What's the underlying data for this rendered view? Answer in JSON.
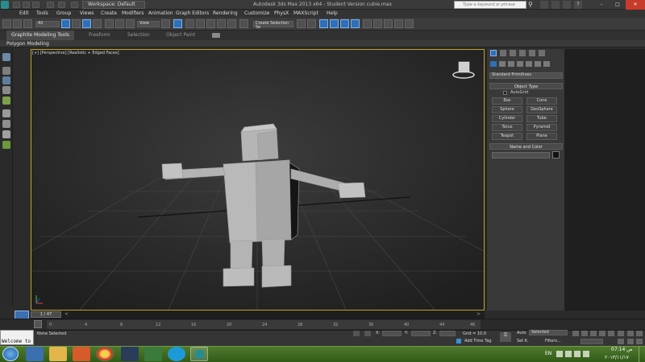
{
  "title_bar": {
    "title": "Autodesk 3ds Max  2013 x64  -  Student Version  cubie.max",
    "workspace": "Workspace: Default",
    "search_placeholder": "Type a keyword or phrase"
  },
  "menu": [
    "Edit",
    "Tools",
    "Group",
    "Views",
    "Create",
    "Modifiers",
    "Animation",
    "Graph Editors",
    "Rendering",
    "Customize",
    "MAXScript",
    "Help"
  ],
  "menu_extra": "PhysX",
  "toolbar": {
    "selection_filter": "All",
    "reference_coord": "View",
    "named_selection": "Create Selection Se"
  },
  "ribbon": {
    "tabs": [
      "Graphite Modeling Tools",
      "Freeform",
      "Selection",
      "Object Paint"
    ],
    "subpanel": "Polygon Modeling"
  },
  "viewport": {
    "label": "[+] [Perspective] [Realistic + Edged Faces]"
  },
  "command_panel": {
    "category": "Standard Primitives",
    "object_type_header": "Object Type",
    "autogrid_label": "AutoGrid",
    "buttons": [
      "Box",
      "Cone",
      "Sphere",
      "GeoSphere",
      "Cylinder",
      "Tube",
      "Torus",
      "Pyramid",
      "Teapot",
      "Plane"
    ],
    "name_color_header": "Name and Color"
  },
  "timeline": {
    "frame_counter": "1 / 47",
    "ticks": [
      "0",
      "4",
      "8",
      "12",
      "16",
      "20",
      "24",
      "28",
      "32",
      "36",
      "40",
      "44",
      "46"
    ]
  },
  "status": {
    "selection": "None Selected",
    "x_label": "X:",
    "y_label": "Y:",
    "z_label": "Z:",
    "grid": "Grid = 10.0",
    "add_time_tag": "Add Time Tag",
    "auto": "Auto",
    "set_key": "Set K.",
    "key_mode": "Selected",
    "filters": "Filters...",
    "welcome": "Welcome to"
  },
  "taskbar": {
    "lang": "EN",
    "time": "07:14 ص",
    "date": "٢٠١٣/١١/١٧"
  },
  "colors": {
    "viewport_border": "#c3a02a",
    "accent_blue": "#2e6fb8",
    "taskbar_green": "#4f7a2d"
  }
}
